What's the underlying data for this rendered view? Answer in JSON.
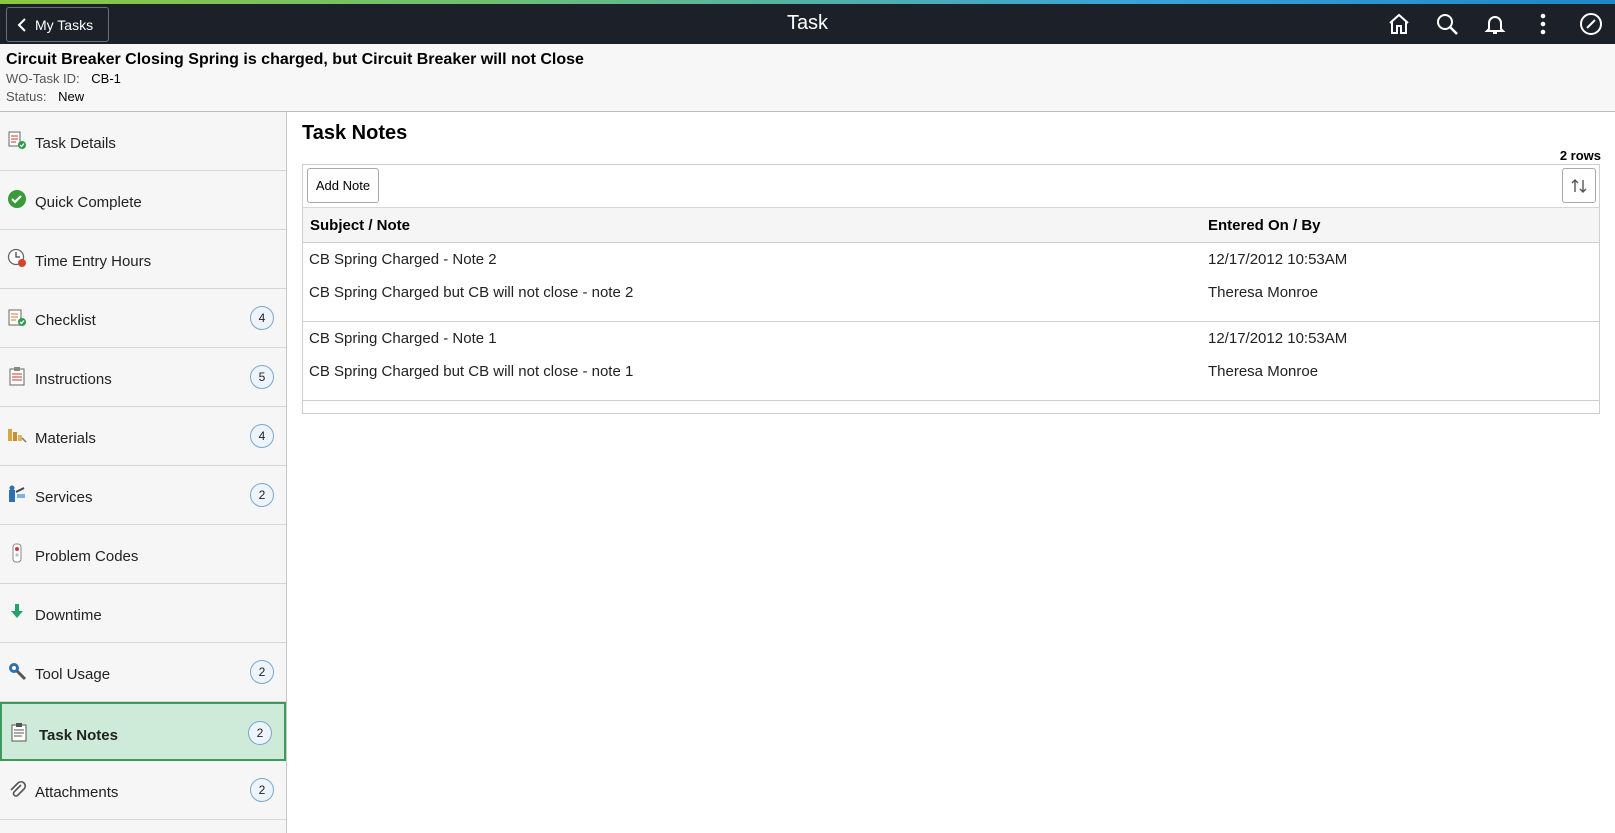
{
  "banner": {
    "back_label": "My Tasks",
    "title": "Task",
    "icons": [
      "home-icon",
      "search-icon",
      "bell-icon",
      "more-vertical-icon",
      "compass-icon"
    ]
  },
  "header": {
    "title": "Circuit Breaker Closing Spring is charged, but Circuit Breaker will not Close",
    "task_id_label": "WO-Task ID:",
    "task_id": "CB-1",
    "status_label": "Status:",
    "status": "New"
  },
  "sidebar": {
    "items": [
      {
        "label": "Task Details",
        "icon": "task-details-icon",
        "badge": ""
      },
      {
        "label": "Quick Complete",
        "icon": "check-circle-icon",
        "badge": ""
      },
      {
        "label": "Time Entry Hours",
        "icon": "clock-icon",
        "badge": ""
      },
      {
        "label": "Checklist",
        "icon": "checklist-icon",
        "badge": "4"
      },
      {
        "label": "Instructions",
        "icon": "clipboard-icon",
        "badge": "5"
      },
      {
        "label": "Materials",
        "icon": "materials-icon",
        "badge": "4"
      },
      {
        "label": "Services",
        "icon": "services-icon",
        "badge": "2"
      },
      {
        "label": "Problem Codes",
        "icon": "traffic-light-icon",
        "badge": ""
      },
      {
        "label": "Downtime",
        "icon": "arrow-down-icon",
        "badge": ""
      },
      {
        "label": "Tool Usage",
        "icon": "wrench-gear-icon",
        "badge": "2"
      },
      {
        "label": "Task Notes",
        "icon": "notes-icon",
        "badge": "2"
      },
      {
        "label": "Attachments",
        "icon": "paperclip-icon",
        "badge": "2"
      }
    ],
    "active_index": 10
  },
  "main": {
    "title": "Task Notes",
    "row_count": "2 rows",
    "add_note_label": "Add Note",
    "columns": [
      "Subject / Note",
      "Entered On / By"
    ],
    "rows": [
      {
        "subject": "CB Spring Charged - Note 2",
        "note": "CB Spring Charged but CB will not close - note 2",
        "date": "12/17/2012 10:53AM",
        "by": "Theresa Monroe"
      },
      {
        "subject": "CB Spring Charged - Note 1",
        "note": "CB Spring Charged but CB will not close - note 1",
        "date": "12/17/2012 10:53AM",
        "by": "Theresa Monroe"
      }
    ]
  },
  "colors": {
    "banner": "#1c2129",
    "active_item": "#cdebd8",
    "active_border": "#3d9a5b",
    "badge_border": "#7aa6d0"
  }
}
